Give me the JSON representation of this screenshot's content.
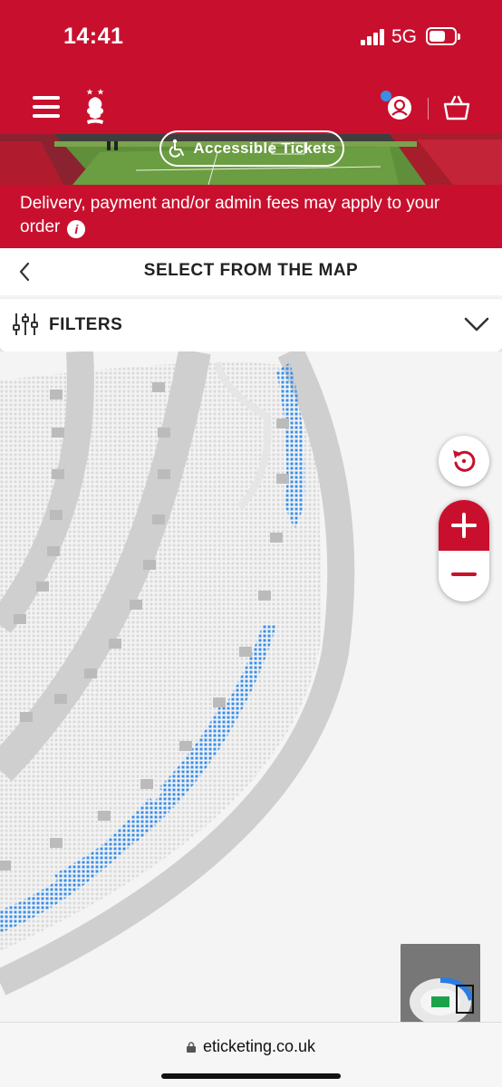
{
  "status": {
    "time": "14:41",
    "network": "5G"
  },
  "header": {
    "crest_text": "FOREST"
  },
  "banner": {
    "accessible_label": "Accessible Tickets"
  },
  "notice": {
    "text": "Delivery, payment and/or admin fees may apply to your order"
  },
  "page": {
    "title": "SELECT FROM THE MAP"
  },
  "filters": {
    "label": "FILTERS"
  },
  "browser": {
    "url": "eticketing.co.uk"
  },
  "colors": {
    "brand_red": "#c8102e",
    "available_seat": "#3a8ee6",
    "unavailable_seat": "#dcdcdc",
    "walkway": "#cfcfcf"
  },
  "icons": [
    "menu-icon",
    "club-crest",
    "account-icon",
    "basket-icon",
    "accessible-icon",
    "info-icon",
    "back-chevron-icon",
    "filter-sliders-icon",
    "chevron-down-icon",
    "reset-icon",
    "zoom-in-icon",
    "zoom-out-icon",
    "lock-icon"
  ]
}
